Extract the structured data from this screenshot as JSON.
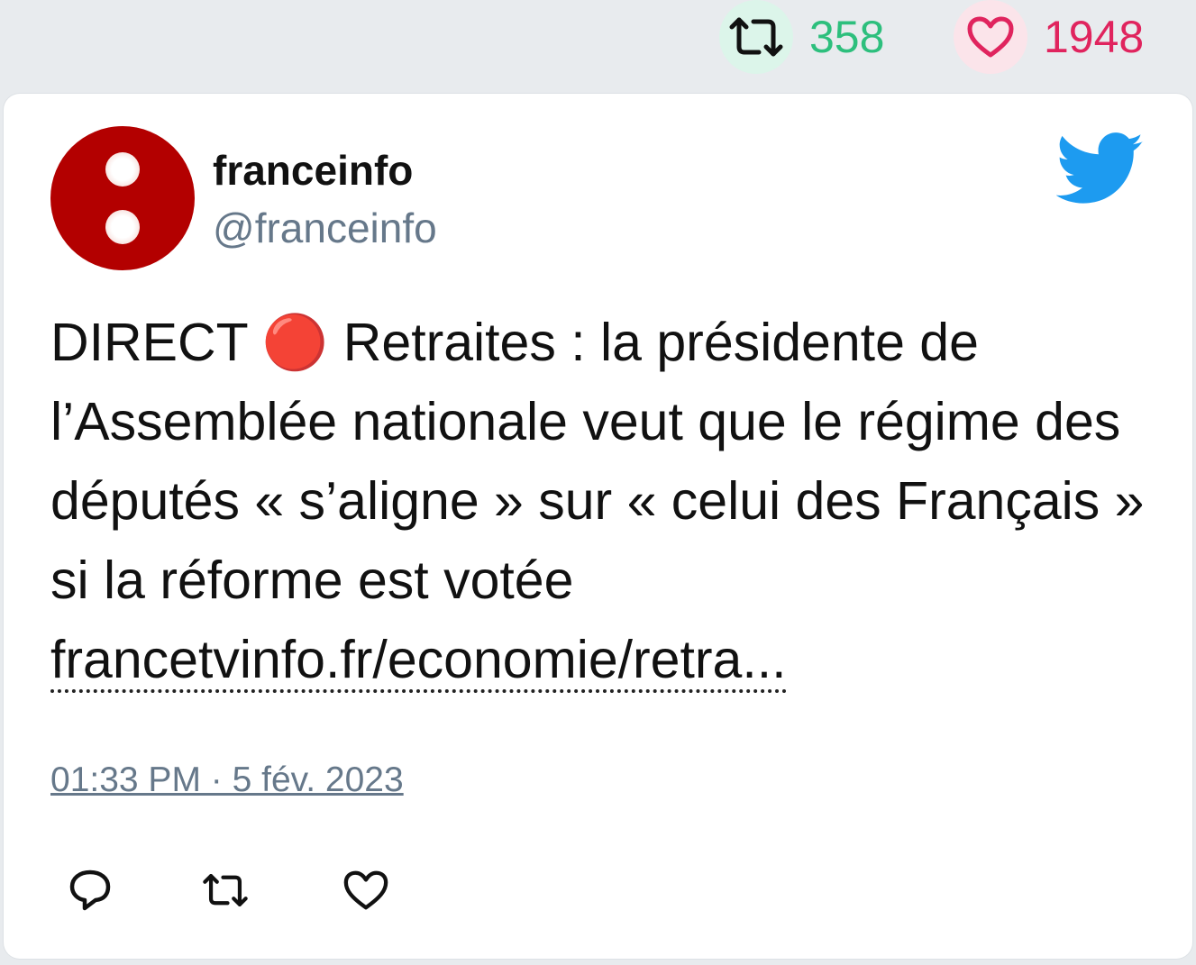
{
  "stats": {
    "retweet_icon": "retweet-icon",
    "retweet_count": "358",
    "like_icon": "heart-icon",
    "like_count": "1948",
    "retweet_color": "#2dbf7d",
    "like_color": "#e0245e"
  },
  "tweet": {
    "author": {
      "name": "franceinfo",
      "handle": "@franceinfo",
      "avatar": "franceinfo-logo"
    },
    "brand_icon": "twitter-bird-icon",
    "brand_color": "#1d9bf0",
    "text_main": "DIRECT 🔴 Retraites : la présidente de l’Assemblée nationale veut que le régime des députés « s’aligne » sur « celui des Français » si la réforme est votée",
    "link_text": "francetvinfo.fr/economie/retra...",
    "timestamp": "01:33 PM · 5 fév. 2023",
    "actions": [
      "reply-icon",
      "retweet-icon",
      "like-icon"
    ]
  }
}
